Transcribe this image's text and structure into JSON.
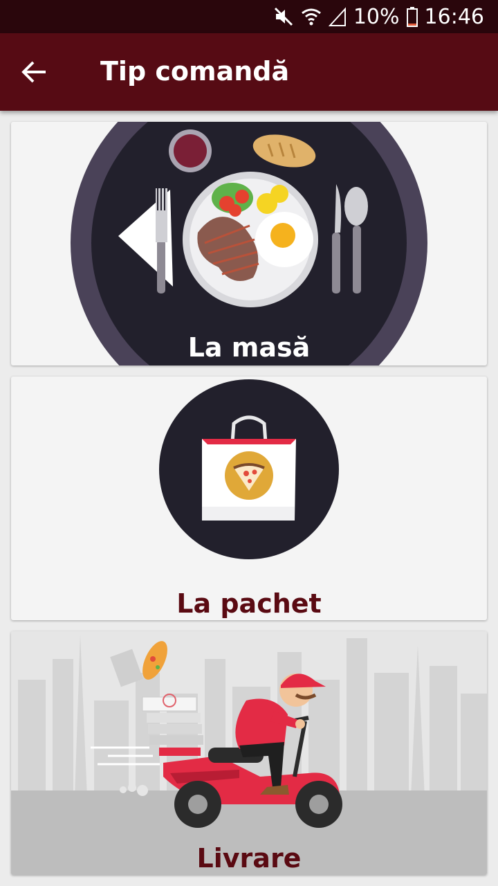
{
  "status_bar": {
    "battery": "10%",
    "time": "16:46"
  },
  "app_bar": {
    "title": "Tip comandă"
  },
  "options": [
    {
      "label": "La masă"
    },
    {
      "label": "La pachet"
    },
    {
      "label": "Livrare"
    }
  ],
  "colors": {
    "status_bar": "#2a060c",
    "app_bar": "#560b14",
    "label_dark": "#5a0a12"
  }
}
